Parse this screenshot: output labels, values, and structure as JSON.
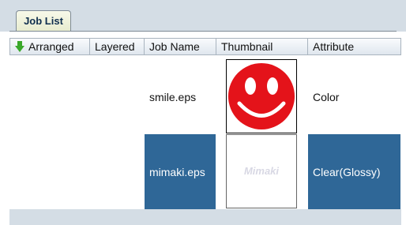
{
  "tabs": [
    {
      "label": "Job List"
    }
  ],
  "columns": {
    "arranged": "Arranged",
    "layered": "Layered",
    "job_name": "Job Name",
    "thumbnail": "Thumbnail",
    "attribute": "Attribute"
  },
  "rows": [
    {
      "job_name": "smile.eps",
      "attribute": "Color",
      "thumbnail_icon": "smiley-face-icon",
      "selected": false
    },
    {
      "job_name": "mimaki.eps",
      "attribute": "Clear(Glossy)",
      "thumbnail_icon": "mimaki-logo",
      "thumbnail_text": "Mimaki",
      "selected": true
    }
  ],
  "colors": {
    "selection": "#2f6797",
    "smiley": "#e4131a",
    "panel": "#d4dde5"
  }
}
